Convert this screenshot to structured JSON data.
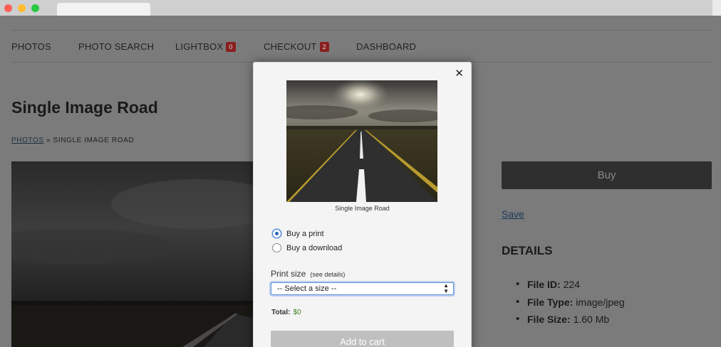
{
  "nav": {
    "items": [
      {
        "label": "PHOTOS"
      },
      {
        "label": "PHOTO SEARCH"
      },
      {
        "label": "LIGHTBOX",
        "badge": "0"
      },
      {
        "label": "CHECKOUT",
        "badge": "2"
      },
      {
        "label": "DASHBOARD"
      }
    ]
  },
  "page": {
    "title": "Single Image Road",
    "breadcrumb": {
      "link": "PHOTOS",
      "separator": "»",
      "current": "SINGLE IMAGE ROAD"
    }
  },
  "sidebar": {
    "buy_label": "Buy",
    "save_label": "Save",
    "details_heading": "DETAILS",
    "details": [
      {
        "key": "File ID:",
        "value": "224"
      },
      {
        "key": "File Type:",
        "value": "image/jpeg"
      },
      {
        "key": "File Size:",
        "value": "1.60 Mb"
      }
    ]
  },
  "modal": {
    "close_glyph": "✕",
    "caption": "Single Image Road",
    "options": [
      {
        "label": "Buy a print",
        "checked": true
      },
      {
        "label": "Buy a download",
        "checked": false
      }
    ],
    "print_size_label": "Print size",
    "see_details": "(see details)",
    "select_value": "-- Select a size --",
    "total_label": "Total:",
    "total_value": "$0",
    "add_to_cart_label": "Add to cart"
  },
  "colors": {
    "badge": "#8a1f1f",
    "accent_blue": "#3b7bd6",
    "total_green": "#3b7d23"
  }
}
